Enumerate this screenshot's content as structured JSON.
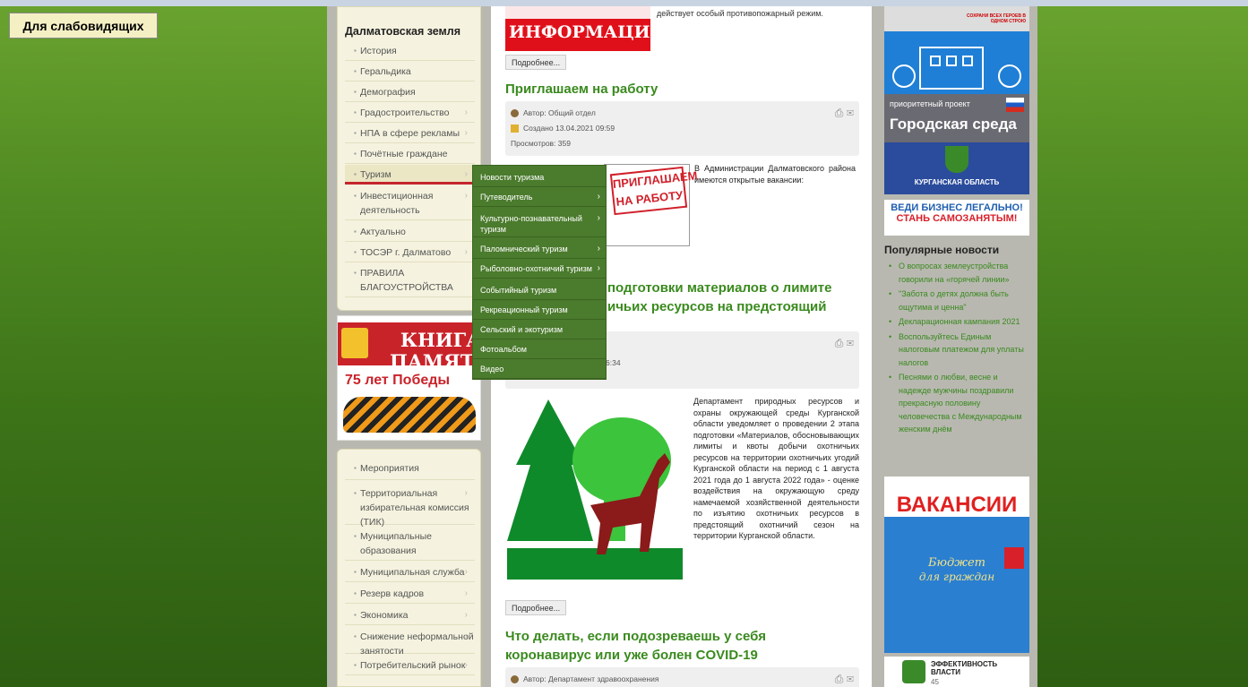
{
  "accessibility_button": "Для слабовидящих",
  "left_menu": {
    "title": "Далматовская земля",
    "items": [
      {
        "label": "История",
        "sub": false
      },
      {
        "label": "Геральдика",
        "sub": false
      },
      {
        "label": "Демография",
        "sub": false
      },
      {
        "label": "Градостроительство",
        "sub": true
      },
      {
        "label": "НПА в сфере рекламы",
        "sub": true
      },
      {
        "label": "Почётные граждане",
        "sub": false
      },
      {
        "label": "Туризм",
        "sub": true
      },
      {
        "label": "Инвестиционная деятельность",
        "sub": true
      },
      {
        "label": "Актуально",
        "sub": false
      },
      {
        "label": "ТОСЭР г. Далматово",
        "sub": true
      },
      {
        "label": "ПРАВИЛА БЛАГОУСТРОЙСТВА",
        "sub": false
      }
    ],
    "items2": [
      {
        "label": "Мероприятия",
        "sub": false
      },
      {
        "label": "Территориальная избирательная комиссия (ТИК)",
        "sub": true
      },
      {
        "label": "Муниципальные образования",
        "sub": false
      },
      {
        "label": "Муниципальная служба",
        "sub": true
      },
      {
        "label": "Резерв кадров",
        "sub": true
      },
      {
        "label": "Экономика",
        "sub": true
      },
      {
        "label": "Снижение неформальной занятости",
        "sub": true
      },
      {
        "label": "Потребительский рынок",
        "sub": true
      }
    ]
  },
  "kniga_banner": {
    "line1": "КНИГА",
    "line2": "ПАМЯТИ",
    "sub": "75 лет   Победы"
  },
  "tourism_submenu": [
    {
      "label": "Новости туризма",
      "sub": false
    },
    {
      "label": "Путеводитель",
      "sub": true
    },
    {
      "label": "Культурно-познавательный туризм",
      "sub": true
    },
    {
      "label": "Паломнический туризм",
      "sub": true
    },
    {
      "label": "Рыболовно-охотничий туризм",
      "sub": true
    },
    {
      "label": "Событийный туризм",
      "sub": false
    },
    {
      "label": "Рекреационный туризм",
      "sub": false
    },
    {
      "label": "Сельский и экотуризм",
      "sub": false
    },
    {
      "label": "Фотоальбом",
      "sub": false
    },
    {
      "label": "Видео",
      "sub": false
    }
  ],
  "articles": {
    "info_banner": "ИНФОРМАЦИЯ",
    "info_text": "действует особый противопожарный режим.",
    "more": "Подробнее...",
    "a1": {
      "title": "Приглашаем на работу",
      "author": "Автор: Общий отдел",
      "created": "Создано 13.04.2021 09:59",
      "views": "Просмотров: 359",
      "pic_text": "ПРИГЛАШАЕМ НА РАБОТУ",
      "body": "В Администрации Далматовского района имеются открытые вакансии:"
    },
    "a2": {
      "title_part1": "подготовки материалов о лимите",
      "title_part2": "ичьих ресурсов на предстоящий",
      "created_frag": "6:34",
      "body": "Департамент природных ресурсов и охраны окружающей среды Курганской области уведомляет о проведении 2 этапа подготовки «Материалов, обосновывающих лимиты и квоты добычи охотничьих ресурсов на территории охотничьих угодий Курганской области на период с 1 августа 2021 года до 1 августа 2022 года» - оценке воздействия на окружающую среду намечаемой хозяйственной деятельности по изъятию охотничьих ресурсов в предстоящий охотничий сезон на территории Курганской области."
    },
    "a3": {
      "title": "Что делать, если подозреваешь у себя коронавирус или уже болен COVID-19",
      "author": "Автор: Департамент здравоохранения"
    }
  },
  "right_col": {
    "gorod_sreda_top": "приоритетный проект",
    "gorod_sreda": "Городская среда",
    "kurgan": "КУРГАНСКАЯ ОБЛАСТЬ",
    "biz_line1": "ВЕДИ БИЗНЕС ЛЕГАЛЬНО!",
    "biz_line2": "СТАНЬ САМОЗАНЯТЫМ!",
    "popular_title": "Популярные новости",
    "popular": [
      "О вопросах землеустройства говорили на «горячей линии»",
      "\"Забота о детях должна быть ощутима и ценна\"",
      "Декларационная кампания 2021",
      "Воспользуйтесь Единым налоговым платежом для уплаты налогов",
      "Песнями о любви, весне и надежде мужчины поздравили прекрасную половину человечества с Международным женским днём"
    ],
    "vacancy": "ВАКАНСИИ",
    "budget1": "Бюджет",
    "budget2": "для граждан",
    "effect": "ЭФФЕКТИВНОСТЬ ВЛАСТИ",
    "effect_num": "45",
    "top_banner": "СОХРАНИ ВСЕХ ГЕРОЕВ В ОДНОМ СТРОЮ"
  }
}
